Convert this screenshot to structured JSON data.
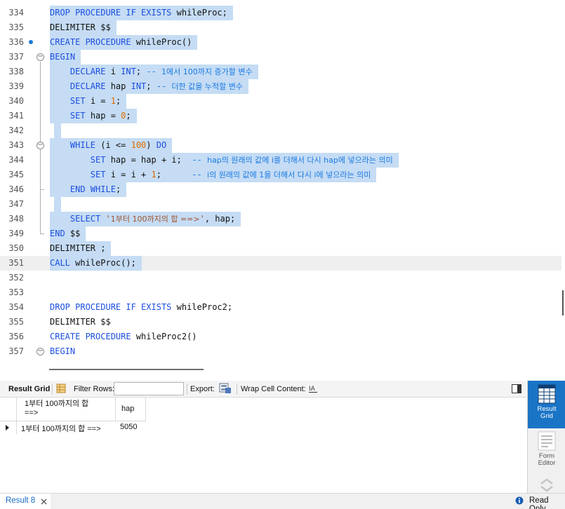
{
  "editor": {
    "lines": [
      {
        "n": "334",
        "sel": true,
        "html": "<span class=\"kw\">DROP PROCEDURE IF EXISTS</span> whileProc;"
      },
      {
        "n": "335",
        "sel": true,
        "html": "DELIMITER $$"
      },
      {
        "n": "336",
        "sel": true,
        "html": "<span class=\"kw\">CREATE PROCEDURE</span> whileProc()"
      },
      {
        "n": "337",
        "sel": true,
        "html": "<span class=\"kw\">BEGIN</span>"
      },
      {
        "n": "338",
        "sel": true,
        "html": "    <span class=\"kw\">DECLARE</span> i <span class=\"kw\">INT</span>; <span class=\"cm\">-- </span><span class=\"cmk\">1에서 100까지 증가할 변수</span>"
      },
      {
        "n": "339",
        "sel": true,
        "html": "    <span class=\"kw\">DECLARE</span> hap <span class=\"kw\">INT</span>; <span class=\"cm\">-- </span><span class=\"cmk\">더한 값을 누적할 변수</span>"
      },
      {
        "n": "340",
        "sel": true,
        "html": "    <span class=\"kw\">SET</span> i = <span class=\"num\">1</span>;"
      },
      {
        "n": "341",
        "sel": true,
        "html": "    <span class=\"kw\">SET</span> hap = <span class=\"num\">0</span>;"
      },
      {
        "n": "342",
        "sel": true,
        "html": ""
      },
      {
        "n": "343",
        "sel": true,
        "html": "    <span class=\"kw\">WHILE</span> (i &lt;= <span class=\"num\">100</span>) <span class=\"kw\">DO</span>"
      },
      {
        "n": "344",
        "sel": true,
        "html": "        <span class=\"kw\">SET</span> hap = hap + i;  <span class=\"cm\">-- </span><span class=\"cmk\">hap의 원래의 값에 i를 더해서 다시 hap에 넣으라는 의미</span>"
      },
      {
        "n": "345",
        "sel": true,
        "html": "        <span class=\"kw\">SET</span> i = i + <span class=\"num\">1</span>;      <span class=\"cm\">-- </span><span class=\"cmk\">i의 원래의 값에 1을 더해서 다시 i에 넣으라는 의미</span>"
      },
      {
        "n": "346",
        "sel": true,
        "html": "    <span class=\"kw\">END WHILE</span>;"
      },
      {
        "n": "347",
        "sel": true,
        "html": ""
      },
      {
        "n": "348",
        "sel": true,
        "html": "    <span class=\"kw\">SELECT</span> <span class=\"str\">'</span><span class=\"strk\">1부터 100까지의 합 ==&gt;</span><span class=\"str\">'</span>, hap;"
      },
      {
        "n": "349",
        "sel": true,
        "html": "<span class=\"kw\">END</span> $$"
      },
      {
        "n": "350",
        "sel": true,
        "html": "DELIMITER ;"
      },
      {
        "n": "351",
        "sel": true,
        "html": "<span class=\"kw\">CALL</span> whileProc();"
      },
      {
        "n": "352",
        "sel": false,
        "html": ""
      },
      {
        "n": "353",
        "sel": false,
        "html": ""
      },
      {
        "n": "354",
        "sel": false,
        "html": "<span class=\"kw\">DROP PROCEDURE IF EXISTS</span> whileProc2;"
      },
      {
        "n": "355",
        "sel": false,
        "html": "DELIMITER $$"
      },
      {
        "n": "356",
        "sel": false,
        "html": "<span class=\"kw\">CREATE PROCEDURE</span> whileProc2()"
      },
      {
        "n": "357",
        "sel": false,
        "html": "<span class=\"kw\">BEGIN</span>"
      }
    ]
  },
  "toolbar": {
    "result_grid_label": "Result Grid",
    "filter_rows_label": "Filter Rows:",
    "filter_rows_value": "",
    "export_label": "Export:",
    "wrap_label": "Wrap Cell Content:"
  },
  "grid": {
    "columns": [
      "1부터 100까지의 합\n==>",
      "hap"
    ],
    "rows": [
      [
        "1부터 100까지의 합 ==>",
        "5050"
      ]
    ]
  },
  "side": {
    "result_grid": "Result\nGrid",
    "form_editor": "Form\nEditor"
  },
  "bottom": {
    "tab_label": "Result 8",
    "status": "Read Only"
  }
}
